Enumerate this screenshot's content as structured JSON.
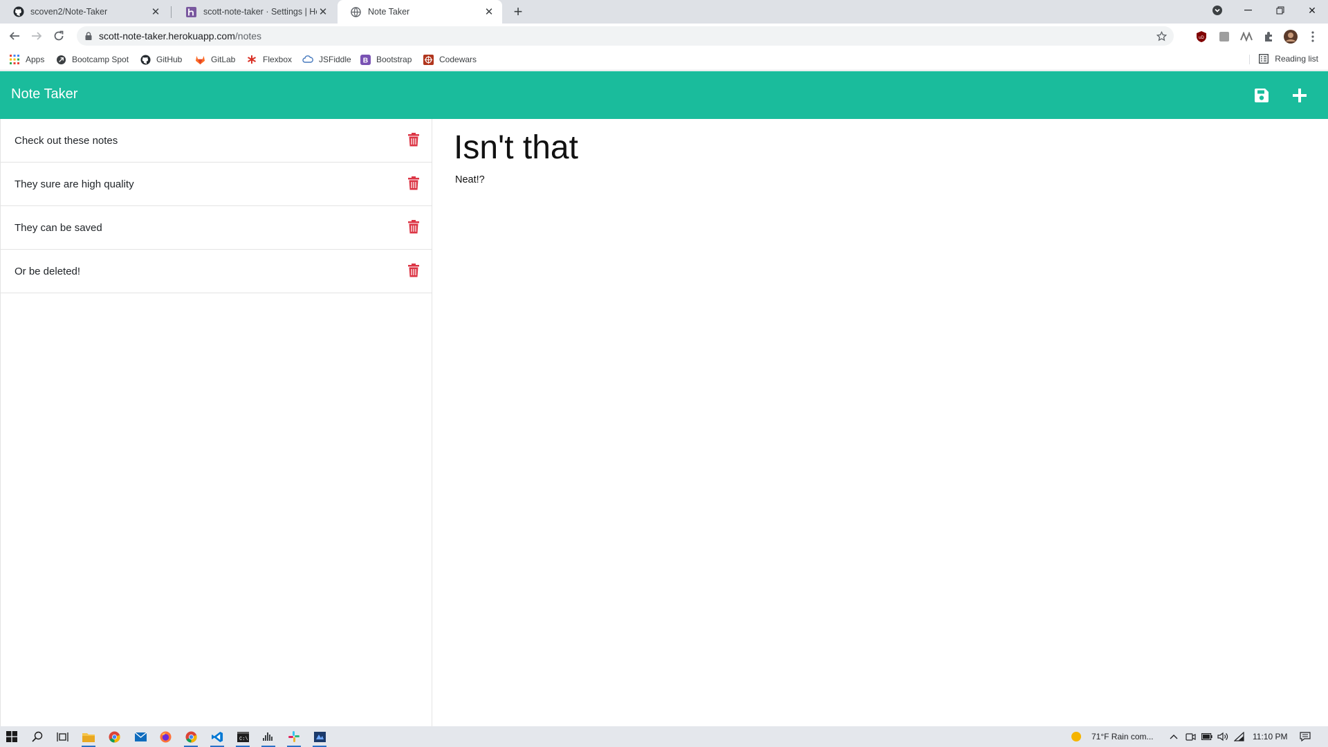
{
  "browser": {
    "tabs": [
      {
        "title": "scoven2/Note-Taker",
        "icon": "github-icon",
        "active": false
      },
      {
        "title": "scott-note-taker · Settings | Hero",
        "icon": "heroku-icon",
        "active": false
      },
      {
        "title": "Note Taker",
        "icon": "globe-icon",
        "active": true
      }
    ],
    "address": {
      "host": "scott-note-taker.herokuapp.com",
      "path": "/notes"
    },
    "bookmarks": [
      {
        "label": "Apps",
        "icon": "apps-grid-icon"
      },
      {
        "label": "Bootcamp Spot",
        "icon": "bootcamp-icon"
      },
      {
        "label": "GitHub",
        "icon": "github-icon"
      },
      {
        "label": "GitLab",
        "icon": "gitlab-icon"
      },
      {
        "label": "Flexbox",
        "icon": "flexbox-icon"
      },
      {
        "label": "JSFiddle",
        "icon": "jsfiddle-icon"
      },
      {
        "label": "Bootstrap",
        "icon": "bootstrap-icon"
      },
      {
        "label": "Codewars",
        "icon": "codewars-icon"
      }
    ],
    "reading_list": "Reading list"
  },
  "app": {
    "brand": "Note Taker",
    "accent_color": "#1abc9c",
    "delete_color": "#dc3545",
    "notes": [
      {
        "title": "Check out these notes"
      },
      {
        "title": "They sure are high quality"
      },
      {
        "title": "They can be saved"
      },
      {
        "title": "Or be deleted!"
      }
    ],
    "editor": {
      "title_value": "Isn't that",
      "text_value": "Neat!?"
    }
  },
  "taskbar": {
    "weather": "71°F  Rain com...",
    "clock": "11:10 PM"
  }
}
